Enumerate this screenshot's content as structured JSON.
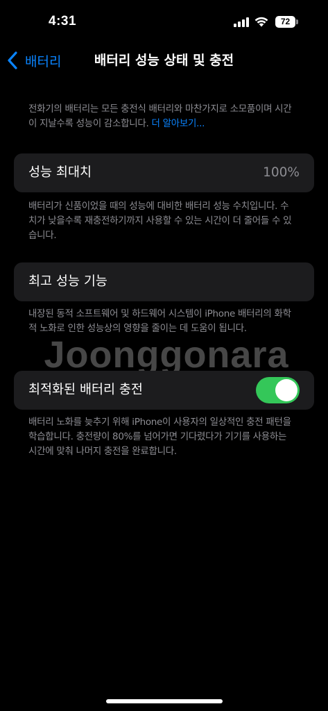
{
  "status_bar": {
    "time": "4:31",
    "battery_level": "72",
    "icons": [
      "signal-icon",
      "wifi-icon",
      "battery-icon"
    ]
  },
  "nav": {
    "back_label": "배터리",
    "title": "배터리 성능 상태 및 충전"
  },
  "intro": {
    "text": "전화기의 배터리는 모든 충전식 배터리와 마찬가지로 소모품이며 시간이 지날수록 성능이 감소합니다.",
    "link": "더 알아보기..."
  },
  "max_capacity": {
    "label": "성능 최대치",
    "value": "100%",
    "footnote": "배터리가 신품이었을 때의 성능에 대비한 배터리 성능 수치입니다. 수치가 낮을수록 재충전하기까지 사용할 수 있는 시간이 더 줄어들 수 있습니다."
  },
  "peak_performance": {
    "label": "최고 성능 기능",
    "footnote": "내장된 동적 소프트웨어 및 하드웨어 시스템이 iPhone 배터리의 화학적 노화로 인한 성능상의 영향을 줄이는 데 도움이 됩니다."
  },
  "optimized_charging": {
    "label": "최적화된 배터리 충전",
    "enabled": true,
    "footnote": "배터리 노화를 늦추기 위해 iPhone이 사용자의 일상적인 충전 패턴을 학습합니다. 충전량이 80%를 넘어가면 기다렸다가 기기를 사용하는 시간에 맞춰 나머지 충전을 완료합니다."
  },
  "watermark": "Joonggonara",
  "colors": {
    "accent": "#0a84ff",
    "toggle_on": "#34c759",
    "cell_background": "#1c1c1e",
    "secondary_text": "#8d8d93"
  }
}
